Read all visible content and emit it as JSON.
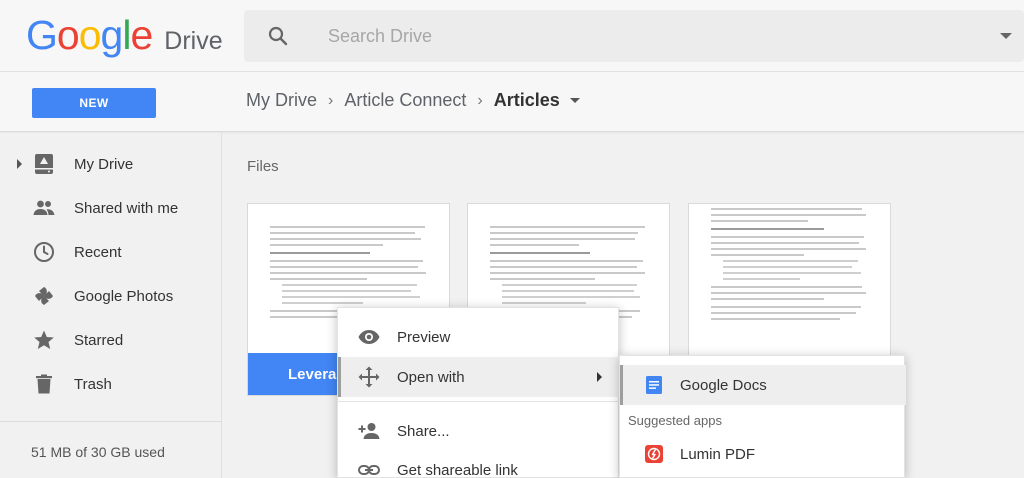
{
  "header": {
    "logo_letters": [
      "G",
      "o",
      "o",
      "g",
      "l",
      "e"
    ],
    "product_name": "Drive",
    "search_placeholder": "Search Drive"
  },
  "toolbar": {
    "new_label": "NEW",
    "breadcrumb": [
      "My Drive",
      "Article Connect",
      "Articles"
    ]
  },
  "sidebar": {
    "items": [
      {
        "label": "My Drive",
        "icon": "drive-icon"
      },
      {
        "label": "Shared with me",
        "icon": "people-icon"
      },
      {
        "label": "Recent",
        "icon": "clock-icon"
      },
      {
        "label": "Google Photos",
        "icon": "pinwheel-icon"
      },
      {
        "label": "Starred",
        "icon": "star-icon"
      },
      {
        "label": "Trash",
        "icon": "trash-icon"
      }
    ],
    "storage": "51 MB of 30 GB used"
  },
  "main": {
    "section_label": "Files",
    "files": [
      {
        "title": "Leverag"
      },
      {
        "title": ""
      },
      {
        "title": ""
      }
    ]
  },
  "context_menu": {
    "items": [
      {
        "label": "Preview",
        "icon": "eye-icon"
      },
      {
        "label": "Open with",
        "icon": "move-arrows-icon"
      },
      {
        "label": "Share...",
        "icon": "add-person-icon"
      },
      {
        "label": "Get shareable link",
        "icon": "link-icon"
      }
    ]
  },
  "submenu": {
    "primary_app": "Google Docs",
    "suggested_heading": "Suggested apps",
    "suggested": [
      "Lumin PDF"
    ]
  },
  "colors": {
    "accent": "#4285f4",
    "docs_blue": "#4285f4",
    "lumin_red": "#ea4335"
  }
}
